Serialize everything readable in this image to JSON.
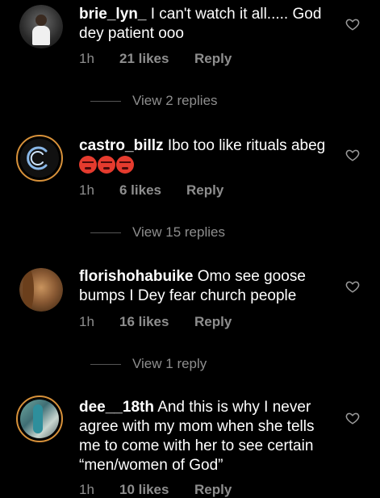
{
  "comments": [
    {
      "username": "brie_lyn_",
      "text": "I can't watch it all..... God dey patient ooo",
      "time": "1h",
      "likes": "21 likes",
      "reply": "Reply",
      "view_replies": "View 2 replies"
    },
    {
      "username": "castro_billz",
      "text": "Ibo too like rituals abeg",
      "emoji": "angry-face-emoji x3",
      "time": "1h",
      "likes": "6 likes",
      "reply": "Reply",
      "view_replies": "View 15 replies"
    },
    {
      "username": "florishohabuike",
      "text": "Omo see goose bumps I Dey fear church people",
      "time": "1h",
      "likes": "16 likes",
      "reply": "Reply",
      "view_replies": "View 1 reply"
    },
    {
      "username": "dee__18th",
      "text": "And this is why I never agree with my mom when she tells me to come with her to see certain “men/women of God”",
      "time": "1h",
      "likes": "10 likes",
      "reply": "Reply"
    }
  ],
  "colors": {
    "background": "#000000",
    "muted": "#8e8e8e",
    "ring": "#d7913a"
  }
}
